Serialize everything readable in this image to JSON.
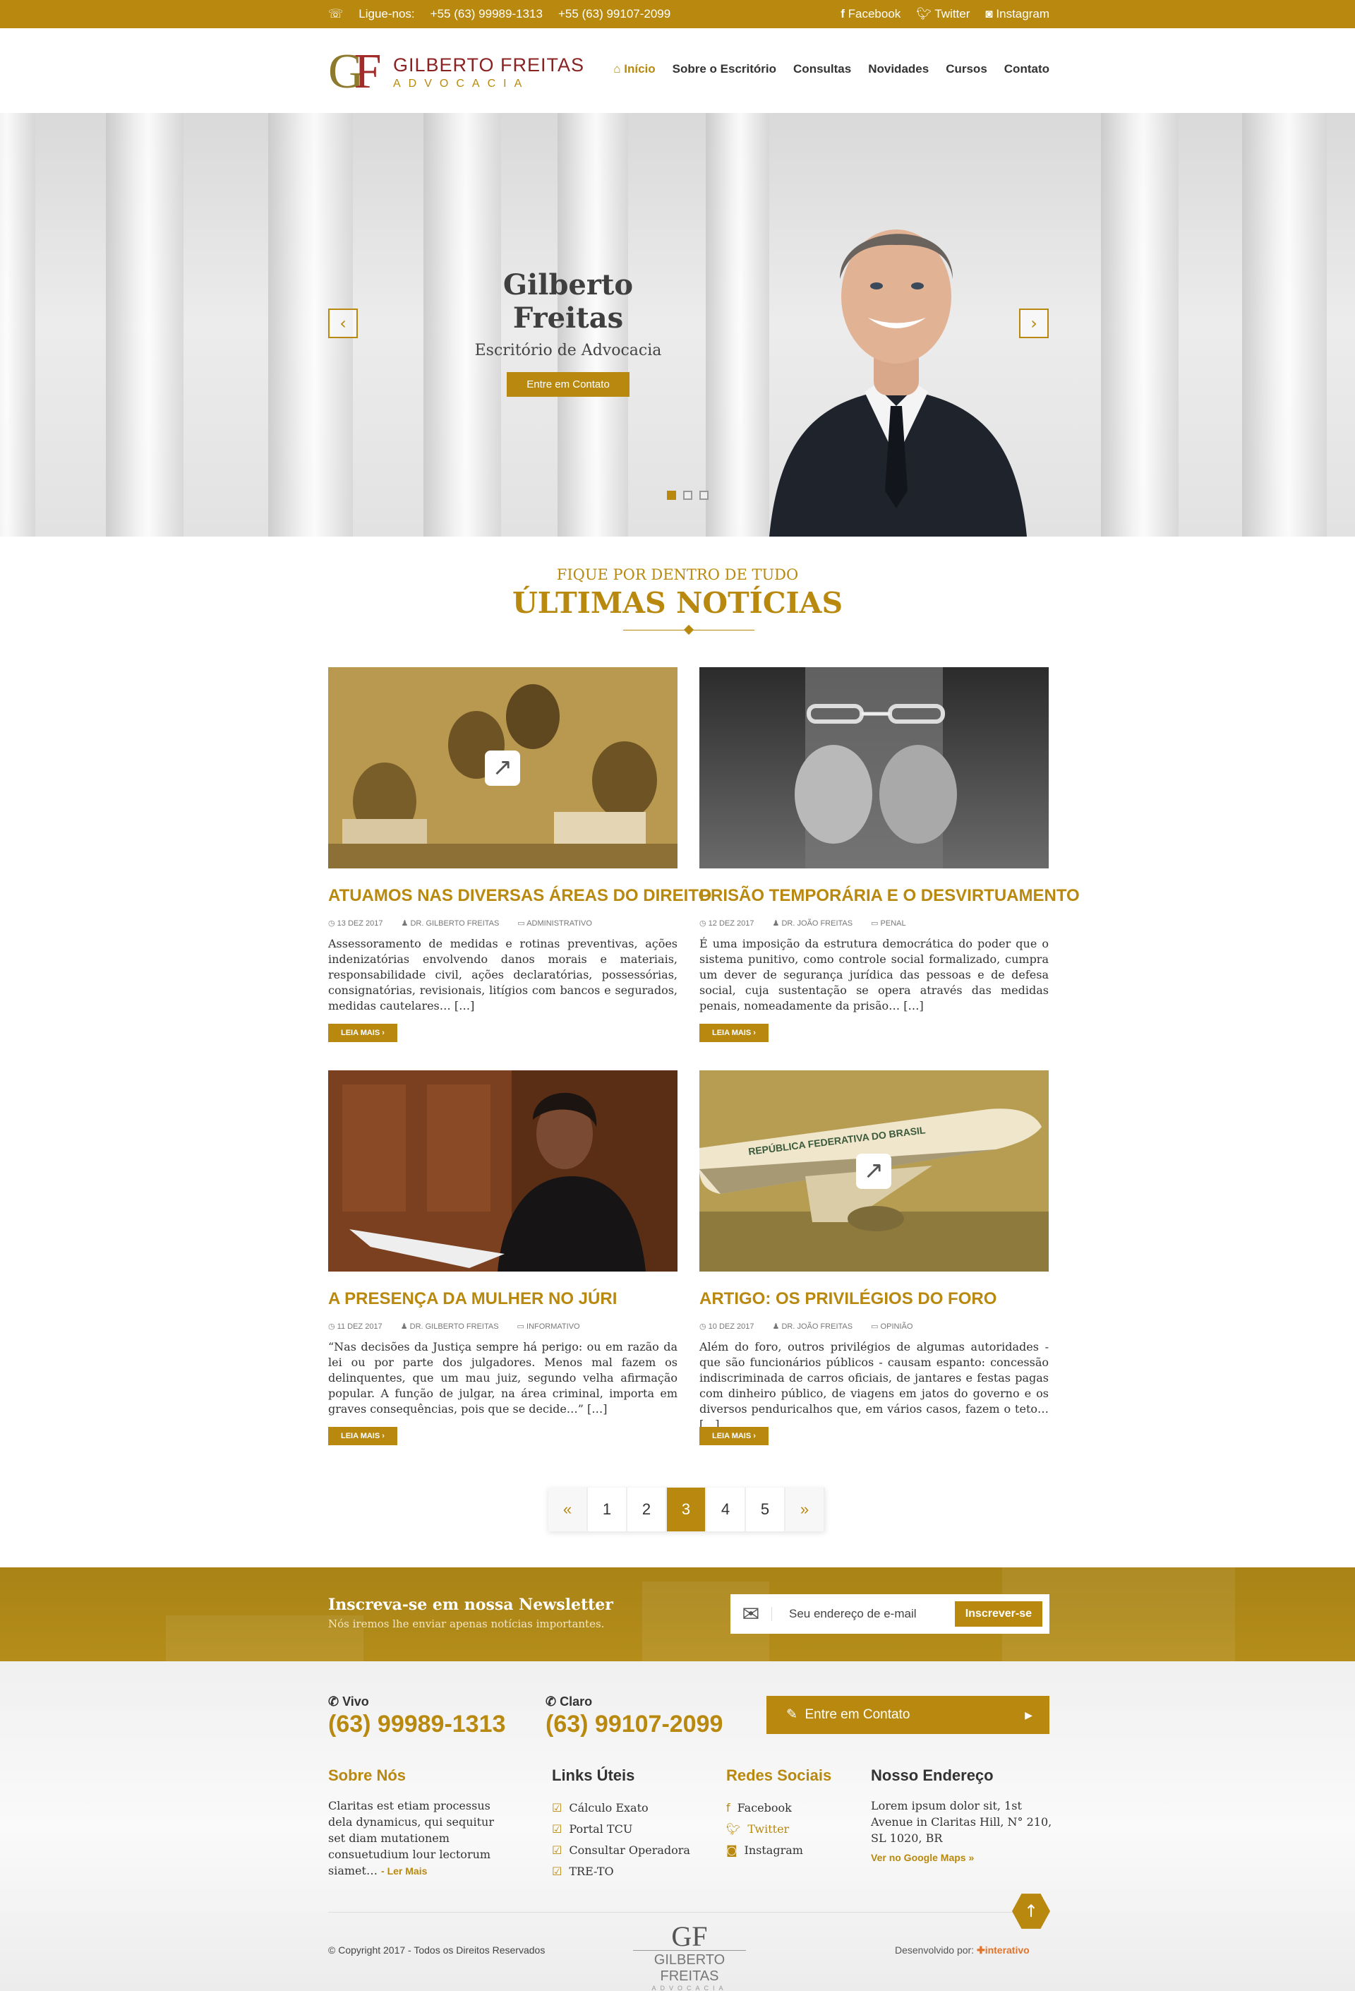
{
  "topbar": {
    "phone_label": "Ligue-nos:",
    "phone1": "+55 (63) 99989-1313",
    "phone2": "+55 (63) 99107-2099",
    "social": [
      "Facebook",
      "Twitter",
      "Instagram"
    ]
  },
  "brand": {
    "mono_g": "G",
    "mono_f": "F",
    "name": "GILBERTO FREITAS",
    "tagline": "ADVOCACIA"
  },
  "nav": [
    "Início",
    "Sobre o Escritório",
    "Consultas",
    "Novidades",
    "Cursos",
    "Contato"
  ],
  "hero": {
    "title": "Gilberto Freitas",
    "subtitle": "Escritório de Advocacia",
    "button": "Entre em Contato",
    "prev": "‹",
    "next": "›"
  },
  "section": {
    "kicker": "FIQUE POR DENTRO DE TUDO",
    "title": "ÚLTIMAS NOTÍCIAS"
  },
  "posts": [
    {
      "title": "ATUAMOS NAS DIVERSAS ÁREAS DO DIREITO",
      "date": "13 DEZ 2017",
      "author": "DR. GILBERTO FREITAS",
      "category": "ADMINISTRATIVO",
      "excerpt": "Assessoramento de medidas e rotinas preventivas, ações indenizatórias envolvendo danos morais e materiais, responsabilidade civil, ações declaratórias, possessórias, consignatórias, revisionais, litígios com bancos e segurados, medidas cautelares… […]",
      "more": "LEIA MAIS ›"
    },
    {
      "title": "PRISÃO TEMPORÁRIA E O DESVIRTUAMENTO",
      "date": "12 DEZ 2017",
      "author": "DR. JOÃO FREITAS",
      "category": "PENAL",
      "excerpt": "É uma imposição da estrutura democrática do poder que o sistema punitivo, como controle social formalizado, cumpra um dever de segurança jurídica das pessoas e de defesa social, cuja sustentação se opera através das medidas penais, nomeadamente da prisão… […]",
      "more": "LEIA MAIS ›"
    },
    {
      "title": "A PRESENÇA DA MULHER NO JÚRI",
      "date": "11 DEZ 2017",
      "author": "DR. GILBERTO FREITAS",
      "category": "INFORMATIVO",
      "excerpt": "“Nas decisões da Justiça sempre há perigo: ou em razão da lei ou por parte dos julgadores. Menos mal fazem os delinquentes, que um mau juiz, segundo velha afirmação popular. A função de julgar, na área criminal, importa em graves consequências, pois que se decide…” […]",
      "more": "LEIA MAIS ›"
    },
    {
      "title": "ARTIGO: OS PRIVILÉGIOS DO FORO",
      "date": "10 DEZ 2017",
      "author": "DR. JOÃO FREITAS",
      "category": "OPINIÃO",
      "excerpt": "Além do foro, outros privilégios de algumas autoridades - que são funcionários públicos - causam espanto: concessão indiscriminada de carros oficiais, de jantares e festas pagas com dinheiro público, de viagens em jatos do governo e os diversos penduricalhos que, em vários casos, fazem o teto… […]",
      "more": "LEIA MAIS ›",
      "plane_text": "REPÚBLICA FEDERATIVA DO BRASIL"
    }
  ],
  "pagination": {
    "prev": "«",
    "pages": [
      "1",
      "2",
      "3",
      "4",
      "5"
    ],
    "current": "3",
    "next": "»"
  },
  "newsletter": {
    "title": "Inscreva-se em nossa Newsletter",
    "subtitle": "Nós iremos lhe enviar apenas notícias importantes.",
    "placeholder": "Seu endereço de e-mail",
    "button": "Inscrever-se"
  },
  "contacts": [
    {
      "label": "Vivo",
      "number": "(63) 99989-1313"
    },
    {
      "label": "Claro",
      "number": "(63) 99107-2099"
    }
  ],
  "cta": "Entre em Contato",
  "footer": {
    "about_title": "Sobre Nós",
    "about_text": "Claritas est etiam processus dela dynamicus, qui sequitur set diam mutationem consuetudium lour lectorum siamet…",
    "about_more": "- Ler Mais",
    "links_title": "Links Úteis",
    "links": [
      "Cálculo Exato",
      "Portal TCU",
      "Consultar Operadora",
      "TRE-TO"
    ],
    "social_title": "Redes Sociais",
    "social": [
      "Facebook",
      "Twitter",
      "Instagram"
    ],
    "address_title": "Nosso Endereço",
    "address": "Lorem ipsum dolor sit, 1st Avenue in Claritas Hill, N° 210, SL 1020, BR",
    "map_link": "Ver no Google Maps »",
    "copyright": "© Copyright 2017 - Todos os Direitos Reservados",
    "logo_mono": "GF",
    "logo_name": "GILBERTO FREITAS",
    "logo_tag": "ADVOCACIA",
    "dev_label": "Desenvolvido por:",
    "dev_name": "interativo"
  },
  "colors": {
    "gold": "#b8890e",
    "wine": "#a22c2a"
  }
}
